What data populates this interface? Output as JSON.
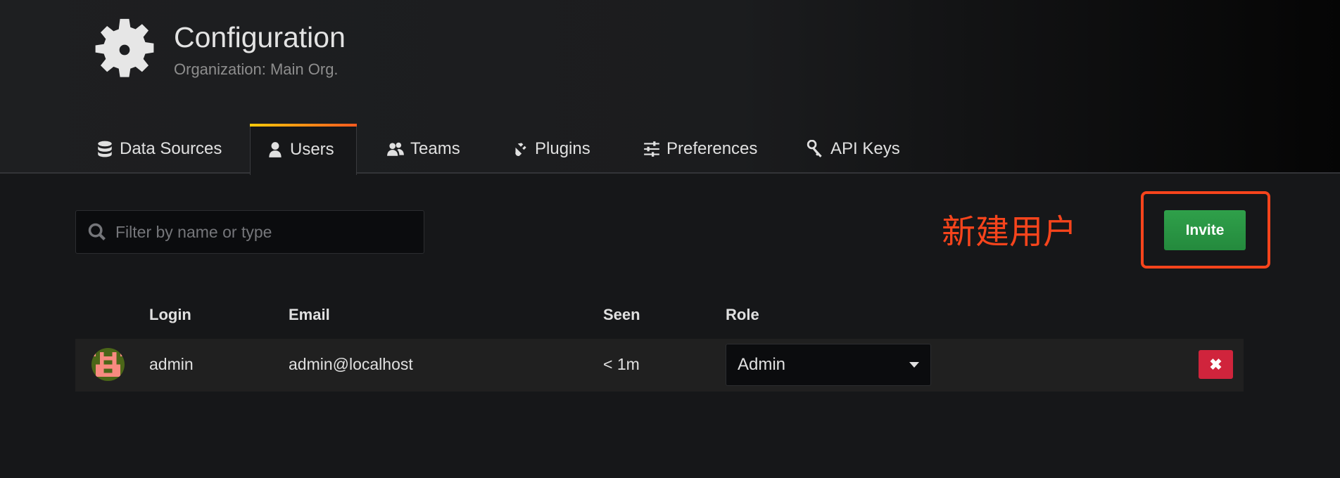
{
  "header": {
    "title": "Configuration",
    "subtitle": "Organization: Main Org."
  },
  "tabs": [
    {
      "label": "Data Sources",
      "icon": "database-icon"
    },
    {
      "label": "Users",
      "icon": "user-icon",
      "active": true
    },
    {
      "label": "Teams",
      "icon": "users-icon"
    },
    {
      "label": "Plugins",
      "icon": "plug-icon"
    },
    {
      "label": "Preferences",
      "icon": "sliders-icon"
    },
    {
      "label": "API Keys",
      "icon": "key-icon"
    }
  ],
  "search": {
    "placeholder": "Filter by name or type",
    "value": ""
  },
  "annotation": "新建用户",
  "invite_label": "Invite",
  "table": {
    "columns": [
      "Login",
      "Email",
      "Seen",
      "Role"
    ],
    "rows": [
      {
        "login": "admin",
        "email": "admin@localhost",
        "seen": "< 1m",
        "role": "Admin"
      }
    ]
  },
  "colors": {
    "accent": "#f6441c",
    "invite": "#299c46",
    "delete": "#d0243c"
  }
}
